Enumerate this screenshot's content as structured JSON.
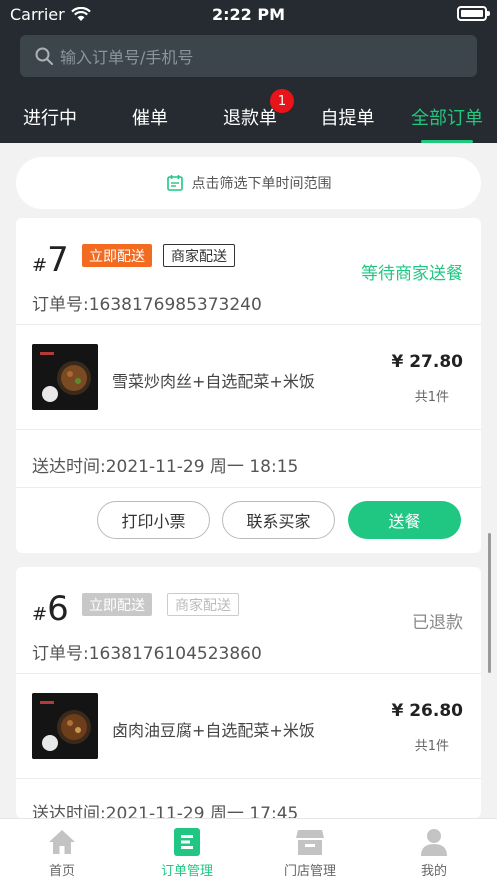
{
  "status_bar": {
    "carrier": "Carrier",
    "time": "2:22 PM"
  },
  "search": {
    "placeholder": "输入订单号/手机号"
  },
  "tabs": [
    {
      "label": "进行中",
      "active": false
    },
    {
      "label": "催单",
      "active": false
    },
    {
      "label": "退款单",
      "active": false,
      "badge": "1"
    },
    {
      "label": "自提单",
      "active": false
    },
    {
      "label": "全部订单",
      "active": true
    }
  ],
  "filter": {
    "label": "点击筛选下单时间范围"
  },
  "orders": [
    {
      "hash": "#",
      "number": "7",
      "tags": [
        "立即配送",
        "商家配送"
      ],
      "status": "等待商家送餐",
      "order_no": "订单号:1638176985373240",
      "item": {
        "name": "雪菜炒肉丝+自选配菜+米饭",
        "price": "¥ 27.80",
        "qty": "共1件"
      },
      "delivery_time": "送达时间:2021-11-29 周一 18:15",
      "actions": [
        "打印小票",
        "联系买家",
        "送餐"
      ]
    },
    {
      "hash": "#",
      "number": "6",
      "tags": [
        "立即配送",
        "商家配送"
      ],
      "status": "已退款",
      "order_no": "订单号:1638176104523860",
      "item": {
        "name": "卤肉油豆腐+自选配菜+米饭",
        "price": "¥ 26.80",
        "qty": "共1件"
      },
      "delivery_time": "送达时间:2021-11-29 周一 17:45"
    }
  ],
  "bottom_nav": [
    {
      "label": "首页",
      "icon": "home-icon",
      "active": false
    },
    {
      "label": "订单管理",
      "icon": "orders-icon",
      "active": true
    },
    {
      "label": "门店管理",
      "icon": "store-icon",
      "active": false
    },
    {
      "label": "我的",
      "icon": "profile-icon",
      "active": false
    }
  ],
  "colors": {
    "accent": "#1fc783",
    "header_bg": "#252b30",
    "orange_tag": "#f26b21",
    "badge": "#e8141a"
  }
}
